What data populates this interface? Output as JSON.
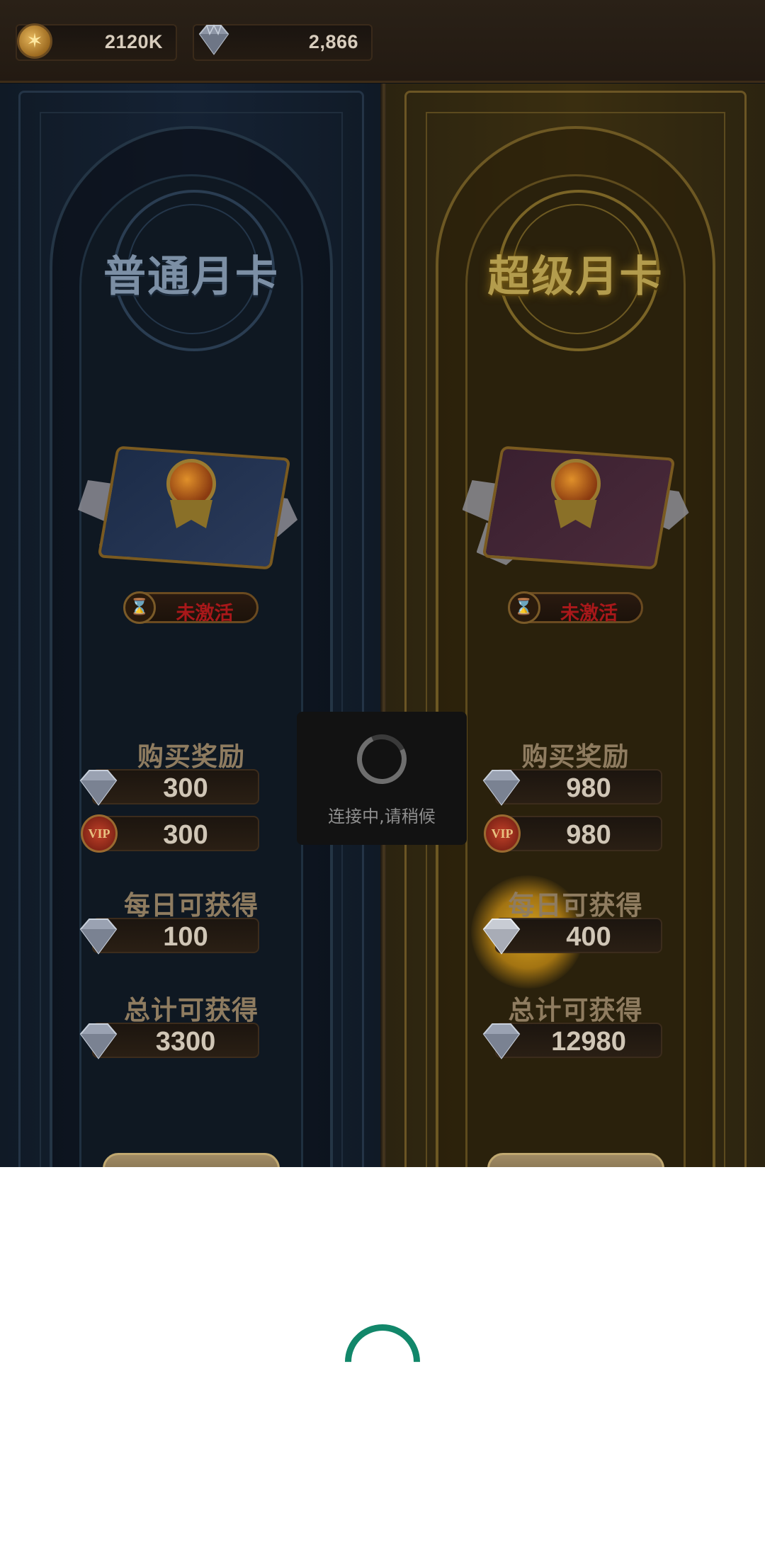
{
  "resources": {
    "gold": "2120K",
    "gems": "2,866"
  },
  "cards": {
    "normal": {
      "title": "普通月卡",
      "status": "未激活",
      "purchase_label": "购买奖励",
      "purchase_gems": "300",
      "purchase_vip": "300",
      "daily_label": "每日可获得",
      "daily_gems": "100",
      "total_label": "总计可获得",
      "total_gems": "3300"
    },
    "super": {
      "title": "超级月卡",
      "status": "未激活",
      "purchase_label": "购买奖励",
      "purchase_gems": "980",
      "purchase_vip": "980",
      "daily_label": "每日可获得",
      "daily_gems": "400",
      "total_label": "总计可获得",
      "total_gems": "12980"
    }
  },
  "vip_badge": "VIP",
  "loading_toast": "连接中,请稍候",
  "colors": {
    "spinner_green": "#12876a",
    "status_red": "#a8181a",
    "overlay_dim": "#0d1116"
  },
  "icons": [
    "coin-icon",
    "diamond-icon",
    "vip-medal-icon",
    "hourglass-icon",
    "loading-spinner-icon"
  ]
}
